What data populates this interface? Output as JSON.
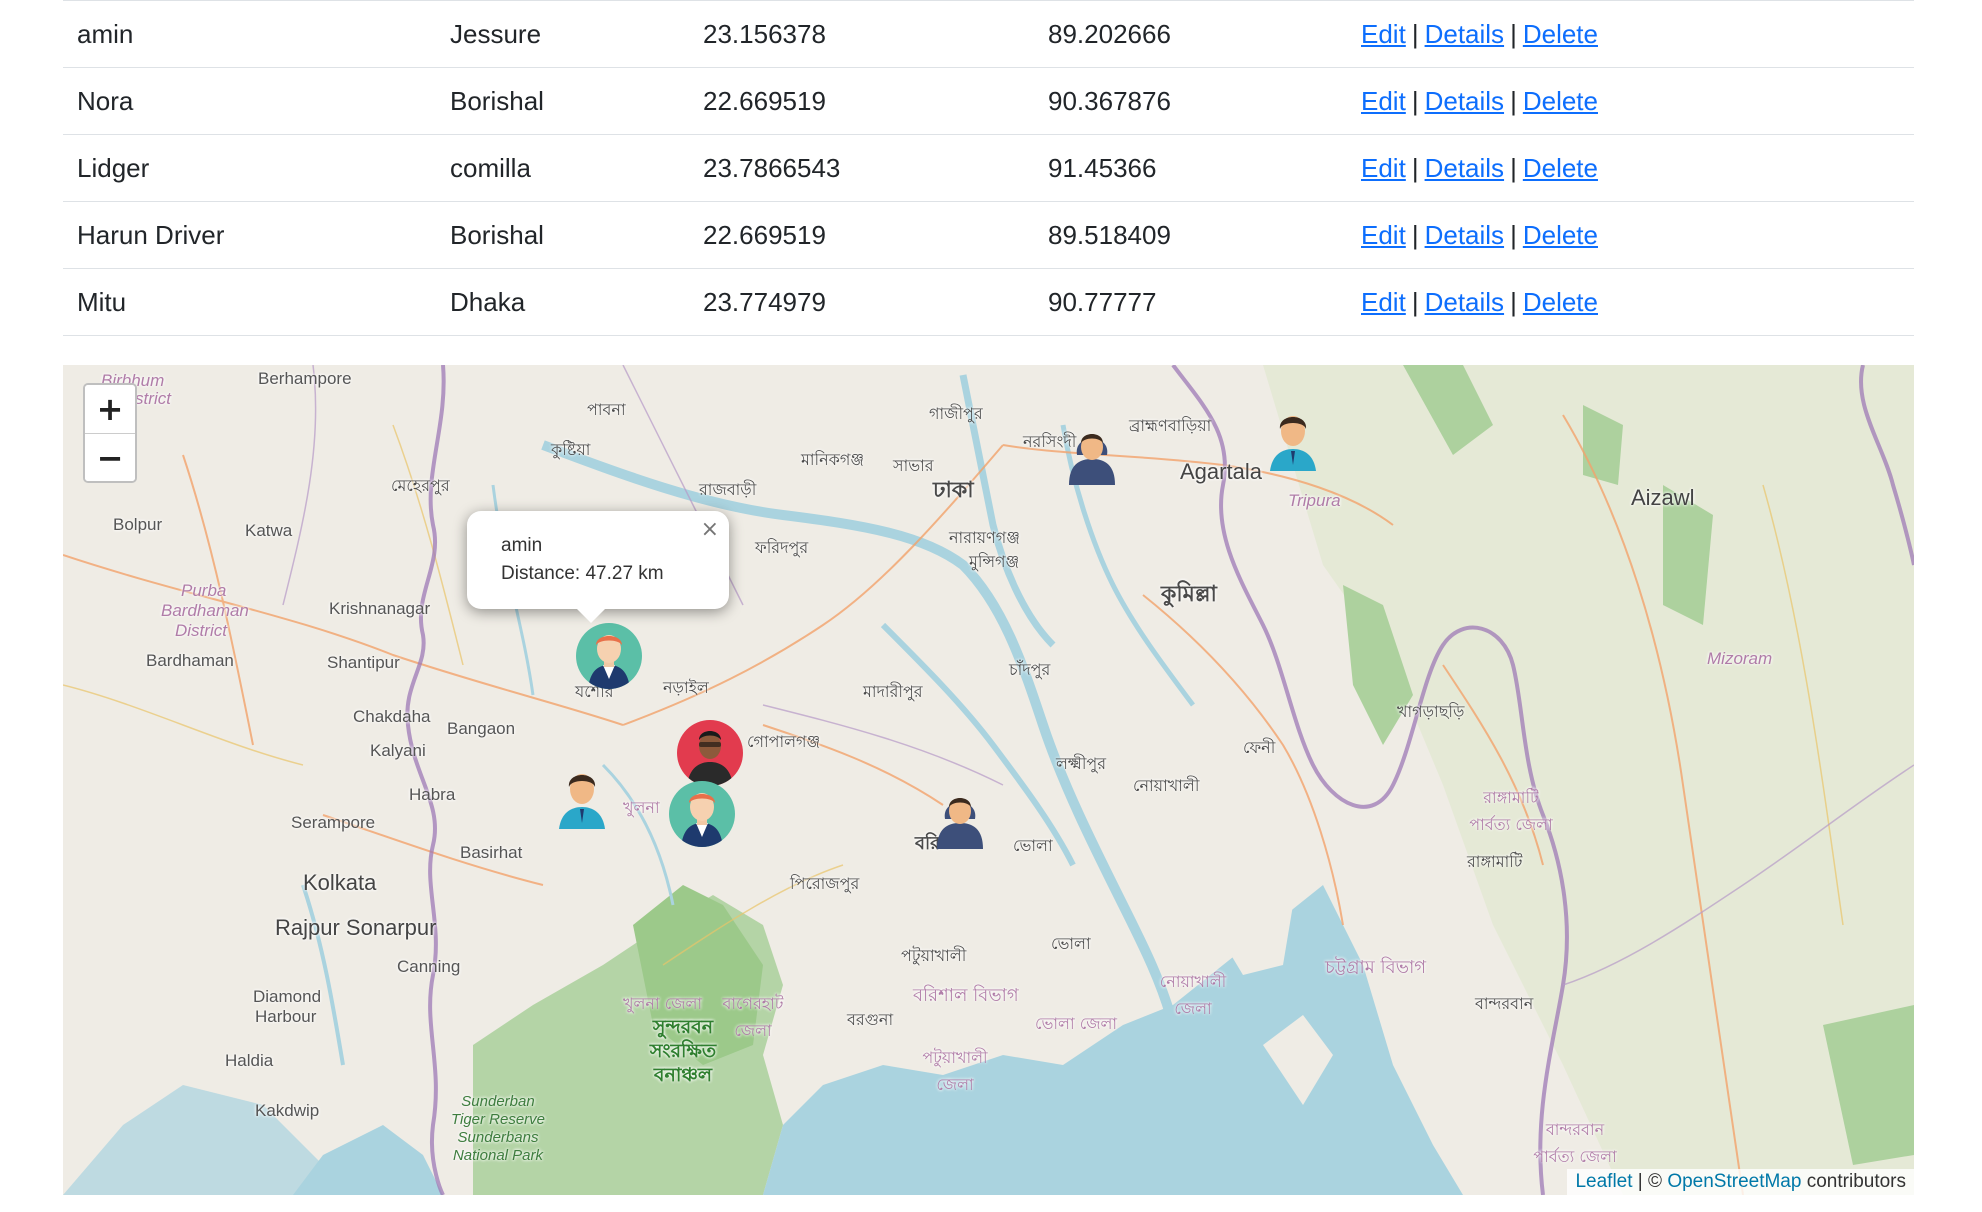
{
  "table": {
    "rows": [
      {
        "name": "amin",
        "city": "Jessure",
        "lat": "23.156378",
        "lng": "89.202666"
      },
      {
        "name": "Nora",
        "city": "Borishal",
        "lat": "22.669519",
        "lng": "90.367876"
      },
      {
        "name": "Lidger",
        "city": "comilla",
        "lat": "23.7866543",
        "lng": "91.45366"
      },
      {
        "name": "Harun Driver",
        "city": "Borishal",
        "lat": "22.669519",
        "lng": "89.518409"
      },
      {
        "name": "Mitu",
        "city": "Dhaka",
        "lat": "23.774979",
        "lng": "90.77777"
      }
    ],
    "actions": {
      "edit": "Edit",
      "details": "Details",
      "delete": "Delete",
      "separator": "|"
    }
  },
  "map": {
    "zoom_in": "+",
    "zoom_out": "−",
    "popup": {
      "close": "×",
      "name": "amin",
      "distance": "Distance: 47.27 km"
    },
    "attribution": {
      "leaflet": "Leaflet",
      "separator": " | © ",
      "osm": "OpenStreetMap",
      "suffix": " contributors"
    },
    "places": {
      "berhampore": "Berhampore",
      "birbhum": "Birbhum",
      "district": "District",
      "bolpur": "Bolpur",
      "katwa": "Katwa",
      "purba": "Purba",
      "bardhaman_region": "Bardhaman",
      "district2": "District",
      "krishnanagar": "Krishnanagar",
      "bardhaman": "Bardhaman",
      "shantipur": "Shantipur",
      "chakdaha": "Chakdaha",
      "kalyani": "Kalyani",
      "bangaon": "Bangaon",
      "habra": "Habra",
      "serampore": "Serampore",
      "basirhat": "Basirhat",
      "kolkata": "Kolkata",
      "rajpur_sonarpur": "Rajpur Sonarpur",
      "canning": "Canning",
      "diamond": "Diamond",
      "harbour": "Harbour",
      "haldia": "Haldia",
      "kakdwip": "Kakdwip",
      "agartala": "Agartala",
      "tripura": "Tripura",
      "aizawl": "Aizawl",
      "mizoram": "Mizoram",
      "sunderban_park": "Sunderban Tiger Reserve Sunderbans National Park",
      "bn_pabna": "পাবনা",
      "bn_kushtia": "কুষ্টিয়া",
      "bn_meherpur": "মেহেরপুর",
      "bn_rajbari": "রাজবাড়ী",
      "bn_manikganj": "মানিকগঞ্জ",
      "bn_savar": "সাভার",
      "bn_gazipur": "গাজীপুর",
      "bn_dhaka": "ঢাকা",
      "bn_narsingdi": "নরসিংদী",
      "bn_brahmanbaria": "ব্রাহ্মণবাড়িয়া",
      "bn_narayanganj": "নারায়ণগঞ্জ",
      "bn_munshiganj": "মুন্সিগঞ্জ",
      "bn_faridpur": "ফরিদপুর",
      "bn_comilla": "কুমিল্লা",
      "bn_chandpur": "চাঁদপুর",
      "bn_madaripur": "মাদারীপুর",
      "bn_narail": "নড়াইল",
      "bn_gopalganj": "গোপালগঞ্জ",
      "bn_khulna": "খুলনা",
      "bn_laxmipur": "লক্ষ্মীপুর",
      "bn_noakhali": "নোয়াখালী",
      "bn_feni": "ফেনী",
      "bn_khagrachhari": "খাগড়াছড়ি",
      "bn_pirojpur": "পিরোজপুর",
      "bn_bhola": "ভোলা",
      "bn_bhola2": "ভোলা",
      "bn_patuakhali": "পটুয়াখালী",
      "bn_barishal_div": "বরিশাল বিভাগ",
      "bn_barguna": "বরগুনা",
      "bn_chattogram_div": "চট্টগ্রাম বিভাগ",
      "bn_rangamati": "রাঙ্গামাটি",
      "bn_rangamati_district": "রাঙ্গামাটি পার্বত্য জেলা",
      "bn_bandarban": "বান্দরবান",
      "bn_bandarban_district": "বান্দরবান পার্বত্য জেলা",
      "bn_khulna_district": "খুলনা জেলা",
      "bn_bagerhat_district": "বাগেরহাট জেলা",
      "bn_bhola_district": "ভোলা জেলা",
      "bn_patuakhali_district": "পটুয়াখালী জেলা",
      "bn_noakhali_district": "নোয়াখালী জেলা",
      "bn_sundarban": "সুন্দরবন সংরক্ষিত বনাঞ্চল",
      "bn_jessore": "যশোর",
      "bn_barishal": "বরি"
    }
  },
  "colors": {
    "link": "#0d6efd",
    "water": "#aad3df",
    "forest": "#add19e",
    "border": "#9e7ab5"
  }
}
